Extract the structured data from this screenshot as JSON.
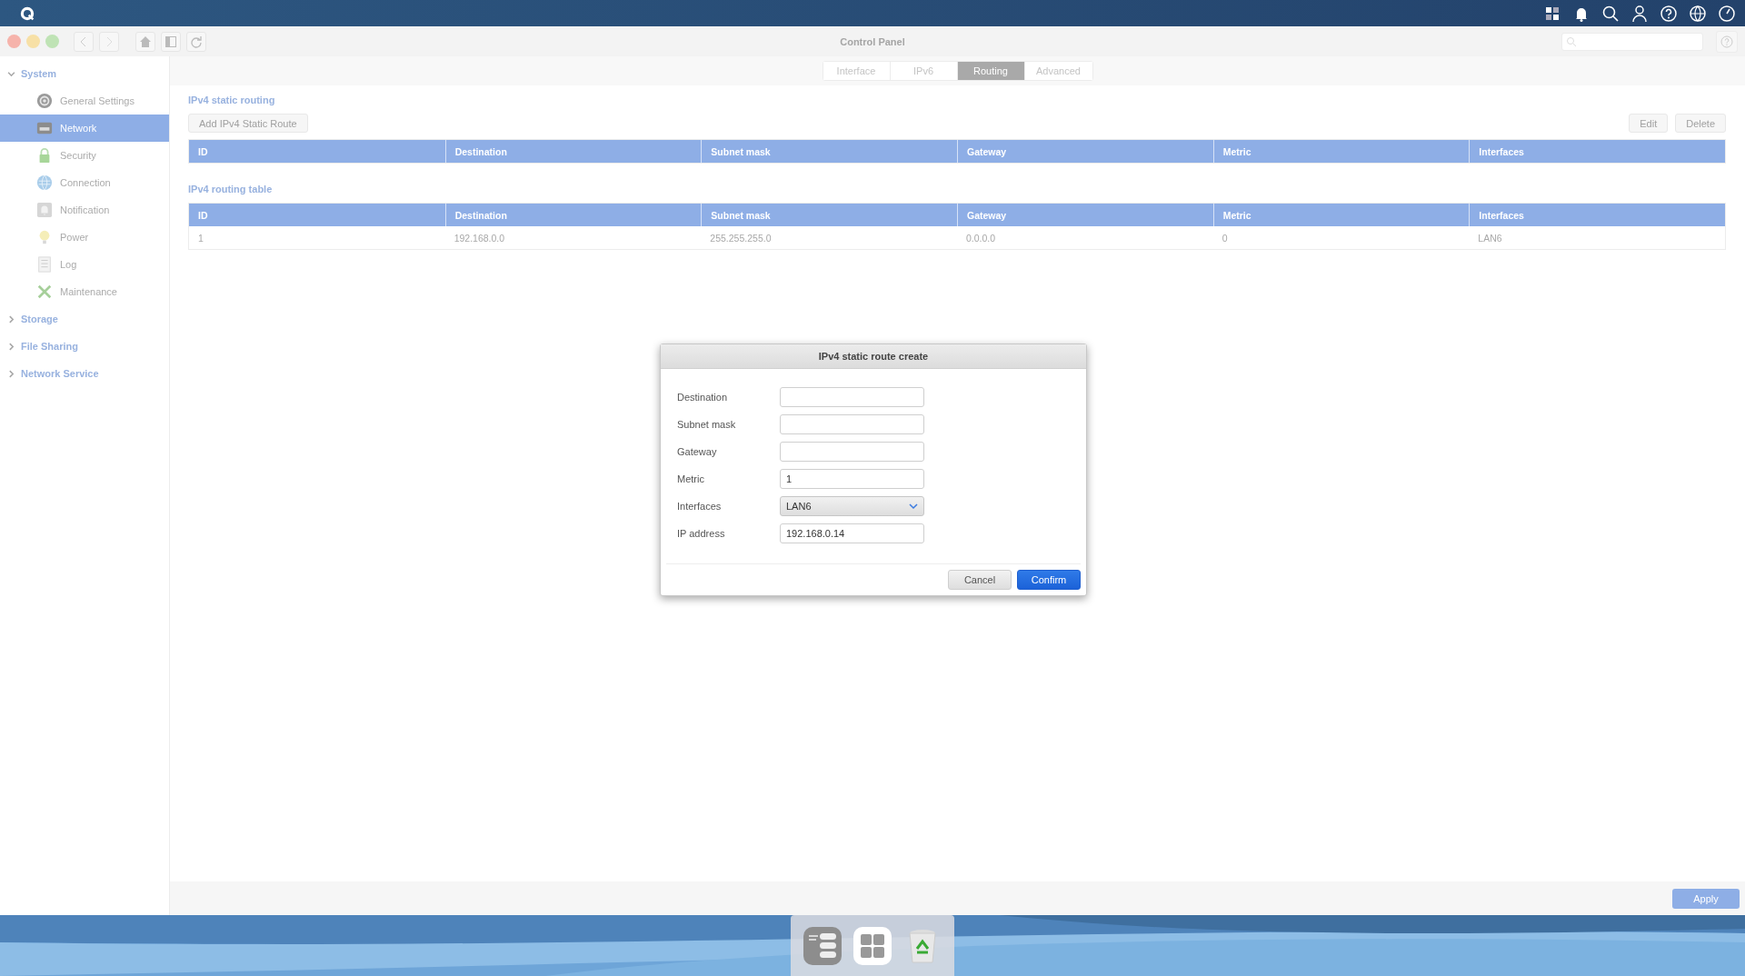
{
  "window": {
    "title": "Control Panel"
  },
  "tabs": [
    {
      "label": "Interface",
      "selected": false
    },
    {
      "label": "IPv6",
      "selected": false
    },
    {
      "label": "Routing",
      "selected": true
    },
    {
      "label": "Advanced",
      "selected": false
    }
  ],
  "sidebar": {
    "sections": [
      {
        "label": "System",
        "expanded": true,
        "children": [
          {
            "label": "General Settings",
            "selected": false
          },
          {
            "label": "Network",
            "selected": true
          },
          {
            "label": "Security",
            "selected": false
          },
          {
            "label": "Connection",
            "selected": false
          },
          {
            "label": "Notification",
            "selected": false
          },
          {
            "label": "Power",
            "selected": false
          },
          {
            "label": "Log",
            "selected": false
          },
          {
            "label": "Maintenance",
            "selected": false
          }
        ]
      },
      {
        "label": "Storage",
        "expanded": false
      },
      {
        "label": "File Sharing",
        "expanded": false
      },
      {
        "label": "Network Service",
        "expanded": false
      }
    ]
  },
  "static_routing": {
    "title": "IPv4 static routing",
    "add_button": "Add IPv4 Static Route",
    "edit_button": "Edit",
    "delete_button": "Delete",
    "columns": [
      "ID",
      "Destination",
      "Subnet mask",
      "Gateway",
      "Metric",
      "Interfaces"
    ]
  },
  "routing_table": {
    "title": "IPv4 routing table",
    "columns": [
      "ID",
      "Destination",
      "Subnet mask",
      "Gateway",
      "Metric",
      "Interfaces"
    ],
    "rows": [
      [
        "1",
        "192.168.0.0",
        "255.255.255.0",
        "0.0.0.0",
        "0",
        "LAN6"
      ]
    ]
  },
  "apply_button": "Apply",
  "dialog": {
    "title": "IPv4 static route create",
    "fields": [
      {
        "label": "Destination",
        "kind": "text"
      },
      {
        "label": "Subnet mask",
        "kind": "text"
      },
      {
        "label": "Gateway",
        "kind": "text"
      },
      {
        "label": "Metric",
        "kind": "text",
        "value": "1"
      },
      {
        "label": "Interfaces",
        "kind": "select",
        "value": "LAN6"
      },
      {
        "label": "IP address",
        "kind": "text",
        "value": "192.168.0.14"
      }
    ],
    "cancel_button": "Cancel",
    "confirm_button": "Confirm"
  }
}
